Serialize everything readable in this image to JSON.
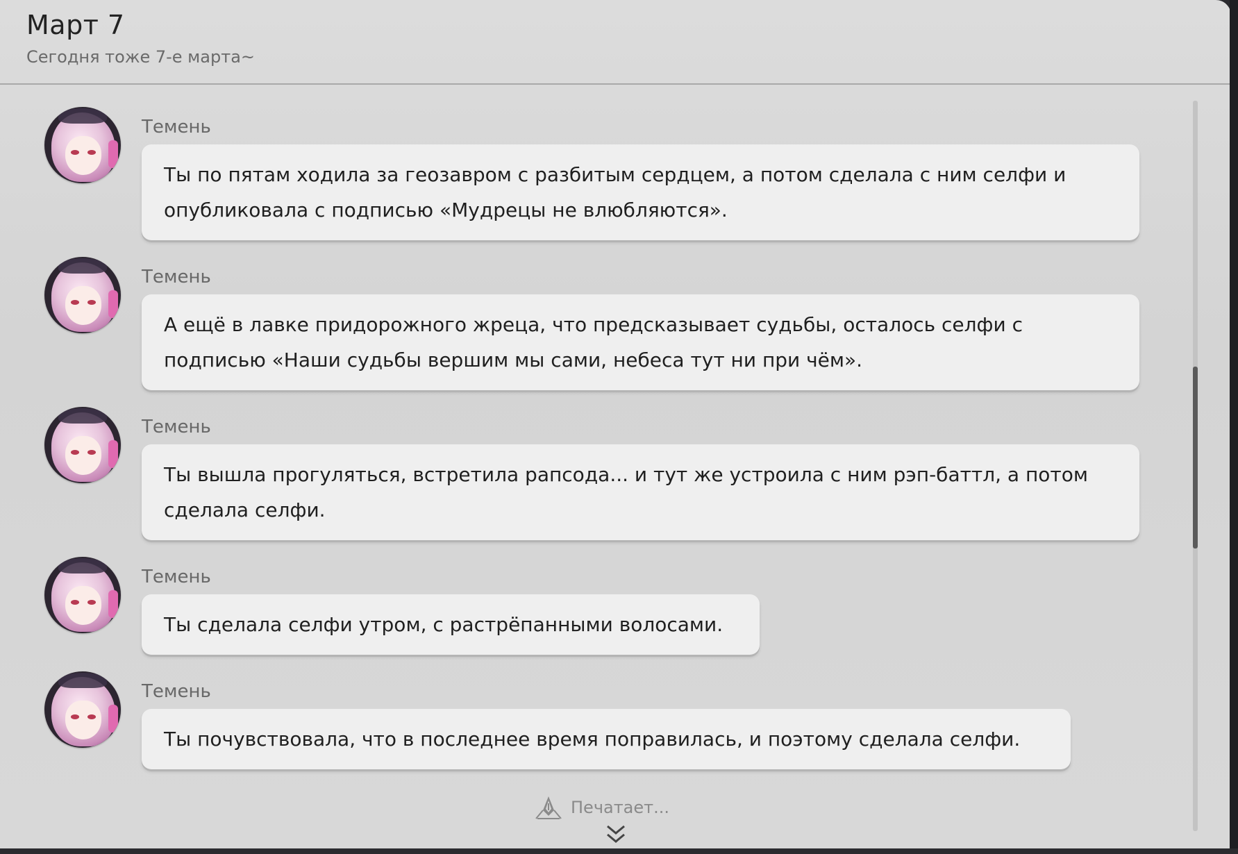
{
  "header": {
    "title": "Март 7",
    "subtitle": "Сегодня тоже 7-е марта~"
  },
  "messages": [
    {
      "sender": "Темень",
      "text": "Ты по пятам ходила за геозавром с разбитым сердцем, а потом сделала с ним селфи и опубликовала с подписью «Мудрецы не влюбляются»."
    },
    {
      "sender": "Темень",
      "text": "А ещё в лавке придорожного жреца, что предсказывает судьбы, осталось селфи с подписью «Наши судьбы вершим мы сами, небеса тут ни при чём»."
    },
    {
      "sender": "Темень",
      "text": "Ты вышла прогуляться, встретила рапсода... и тут же устроила с ним рэп-баттл, а потом сделала селфи."
    },
    {
      "sender": "Темень",
      "text": "Ты сделала селфи утром, с растрёпанными волосами."
    },
    {
      "sender": "Темень",
      "text": "Ты почувствовала, что в последнее время поправилась, и поэтому сделала селфи."
    }
  ],
  "typing_indicator": {
    "label": "Печатает...",
    "icon": "pen-icon"
  },
  "scroll_down_icon": "double-chevron-down-icon",
  "colors": {
    "background": "#d8d8d8",
    "bubble": "#efefef",
    "sender": "#686868",
    "text": "#1f1f1f"
  }
}
